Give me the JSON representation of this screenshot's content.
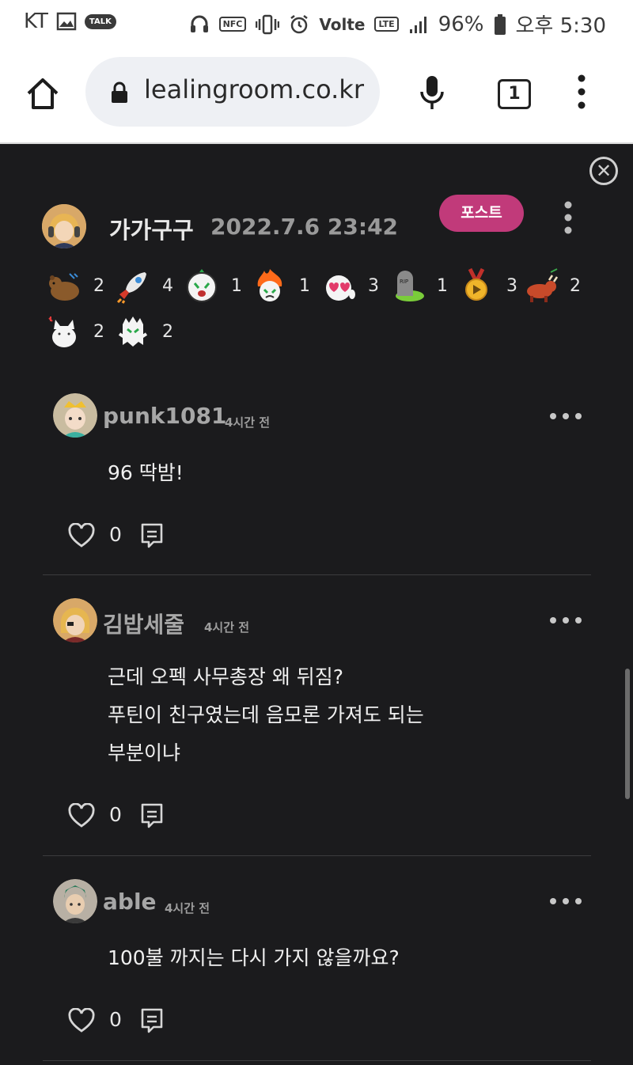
{
  "status_bar": {
    "carrier": "KT",
    "talk_label": "TALK",
    "nfc_label": "NFC",
    "volte_label": "Volte",
    "lte_label": "LTE",
    "battery": "96%",
    "time": "오후 5:30"
  },
  "browser": {
    "url": "lealingroom.co.kr",
    "tab_count": "1"
  },
  "post": {
    "author": "가가구구",
    "date": "2022.7.6 23:42",
    "tag": "포스트",
    "reactions": [
      {
        "icon": "bear-icon",
        "count": "2"
      },
      {
        "icon": "rocket-icon",
        "count": "4"
      },
      {
        "icon": "crying-face-icon",
        "count": "1"
      },
      {
        "icon": "fire-face-icon",
        "count": "1"
      },
      {
        "icon": "heart-eyes-icon",
        "count": "3"
      },
      {
        "icon": "rip-tombstone-icon",
        "count": "1"
      },
      {
        "icon": "gold-medal-icon",
        "count": "3"
      },
      {
        "icon": "bull-icon",
        "count": "2"
      },
      {
        "icon": "white-cat-icon",
        "count": "2"
      },
      {
        "icon": "white-ghost-icon",
        "count": "2"
      }
    ]
  },
  "comments": [
    {
      "user": "punk1081",
      "time": "4시간 전",
      "lines": [
        "96 딱밤!"
      ],
      "likes": "0"
    },
    {
      "user": "김밥세줄",
      "time": "4시간 전",
      "lines": [
        "근데 오펙 사무총장 왜 뒤짐?",
        "푸틴이 친구였는데 음모론 가져도 되는",
        "부분이냐"
      ],
      "likes": "0"
    },
    {
      "user": "able",
      "time": "4시간 전",
      "lines": [
        "100불 까지는 다시 가지 않을까요?"
      ],
      "likes": "0"
    }
  ],
  "colors": {
    "background": "#1b1b1d",
    "tag_pink": "#c13a7a",
    "divider": "#3c3c3e"
  }
}
